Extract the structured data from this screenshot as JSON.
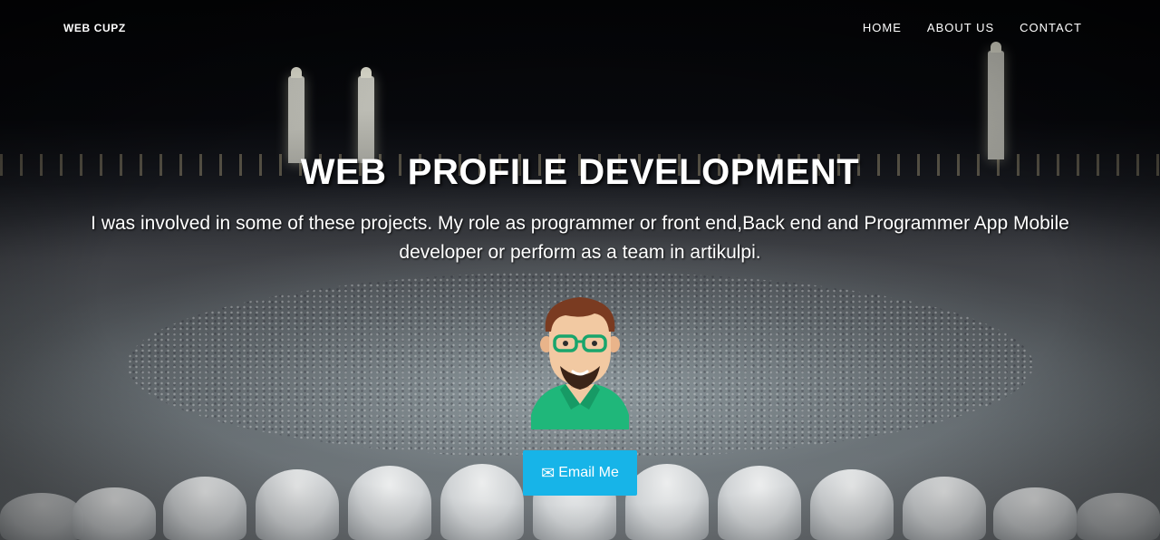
{
  "navbar": {
    "brand": "WEB CUPZ",
    "links": [
      {
        "label": "HOME"
      },
      {
        "label": "ABOUT US"
      },
      {
        "label": "CONTACT"
      }
    ]
  },
  "hero": {
    "title": "WEB  PROFILE DEVELOPMENT",
    "subtitle": "I was involved in some of these projects. My role as programmer or front end,Back end and Programmer App Mobile developer or perform as a team in artikulpi.",
    "avatar_icon": "developer-avatar-icon",
    "button": {
      "label": "Email Me",
      "icon": "envelope-icon",
      "color": "#17b4e8"
    }
  }
}
